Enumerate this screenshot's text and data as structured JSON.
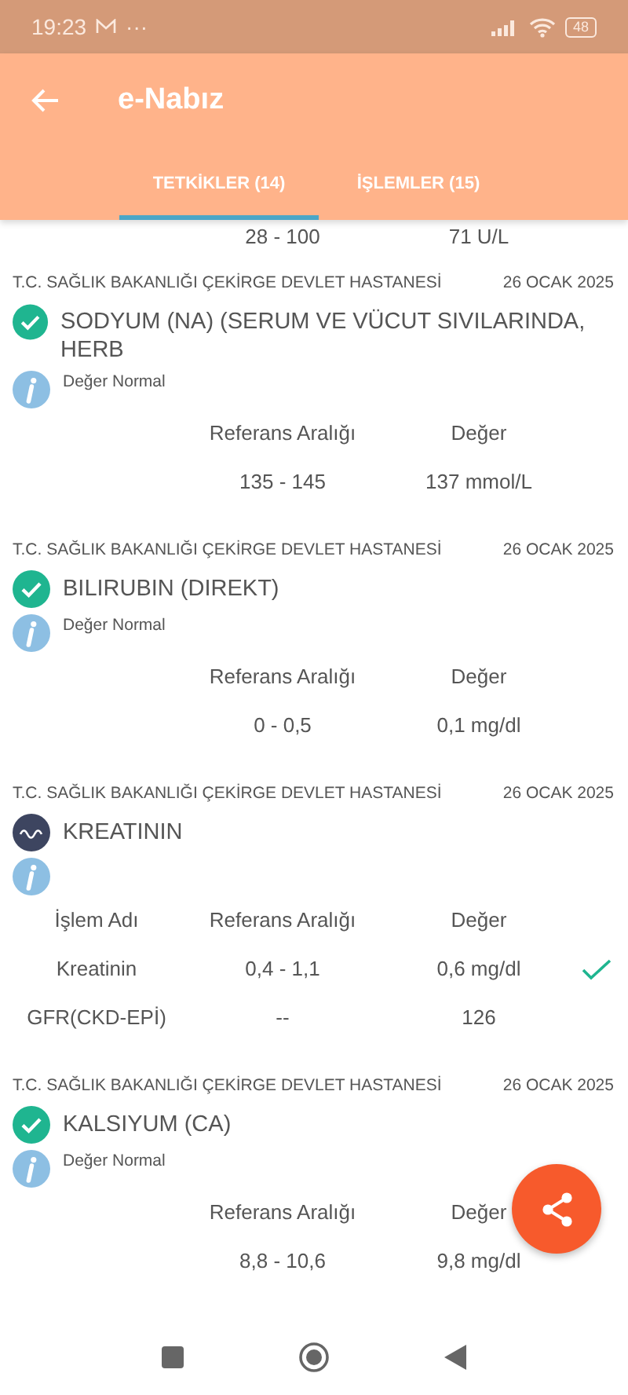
{
  "status_bar": {
    "time": "19:23",
    "extra": "···",
    "battery": "48"
  },
  "app_bar": {
    "title": "e-Nabız"
  },
  "tabs": [
    {
      "label": "TETKİKLER (14)",
      "selected": true
    },
    {
      "label": "İŞLEMLER (15)",
      "selected": false
    }
  ],
  "partial_row": {
    "range": "28 - 100",
    "value": "71 U/L"
  },
  "results": [
    {
      "hospital": "T.C. SAĞLIK BAKANLIĞI ÇEKİRGE DEVLET HASTANESİ",
      "date": "26 OCAK 2025",
      "title": "SODYUM (NA) (SERUM VE VÜCUT SIVILARINDA, HERB",
      "kind": "normal",
      "note": "Değer Normal",
      "headers": [
        {
          "kind": "range",
          "text": "Referans Aralığı"
        },
        {
          "kind": "value",
          "text": "Değer"
        }
      ],
      "rows": [
        {
          "cells": [
            {
              "kind": "range",
              "text": "135 - 145"
            },
            {
              "kind": "value",
              "text": "137 mmol/L"
            }
          ],
          "checked": false
        }
      ]
    },
    {
      "hospital": "T.C. SAĞLIK BAKANLIĞI ÇEKİRGE DEVLET HASTANESİ",
      "date": "26 OCAK 2025",
      "title": "BILIRUBIN (DIREKT)",
      "kind": "normal",
      "note": "Değer Normal",
      "headers": [
        {
          "kind": "range",
          "text": "Referans Aralığı"
        },
        {
          "kind": "value",
          "text": "Değer"
        }
      ],
      "rows": [
        {
          "cells": [
            {
              "kind": "range",
              "text": "0 - 0,5"
            },
            {
              "kind": "value",
              "text": "0,1 mg/dl"
            }
          ],
          "checked": false
        }
      ]
    },
    {
      "hospital": "T.C. SAĞLIK BAKANLIĞI ÇEKİRGE DEVLET HASTANESİ",
      "date": "26 OCAK 2025",
      "title": "KREATININ",
      "kind": "wave",
      "headers": [
        {
          "kind": "name",
          "text": "İşlem Adı"
        },
        {
          "kind": "range",
          "text": "Referans Aralığı"
        },
        {
          "kind": "value",
          "text": "Değer"
        }
      ],
      "rows": [
        {
          "cells": [
            {
              "kind": "name",
              "text": "Kreatinin"
            },
            {
              "kind": "range",
              "text": "0,4 - 1,1"
            },
            {
              "kind": "value",
              "text": "0,6 mg/dl"
            }
          ],
          "checked": true
        },
        {
          "cells": [
            {
              "kind": "name",
              "text": "GFR(CKD-EPİ)"
            },
            {
              "kind": "range",
              "text": "--"
            },
            {
              "kind": "value",
              "text": "126"
            }
          ],
          "checked": false
        }
      ]
    },
    {
      "hospital": "T.C. SAĞLIK BAKANLIĞI ÇEKİRGE DEVLET HASTANESİ",
      "date": "26 OCAK 2025",
      "title": "KALSIYUM (CA)",
      "kind": "normal",
      "note": "Değer Normal",
      "headers": [
        {
          "kind": "range",
          "text": "Referans Aralığı"
        },
        {
          "kind": "value",
          "text": "Değer"
        }
      ],
      "rows": [
        {
          "cells": [
            {
              "kind": "range",
              "text": "8,8 - 10,6"
            },
            {
              "kind": "value",
              "text": "9,8 mg/dl"
            }
          ],
          "checked": false
        }
      ]
    }
  ]
}
